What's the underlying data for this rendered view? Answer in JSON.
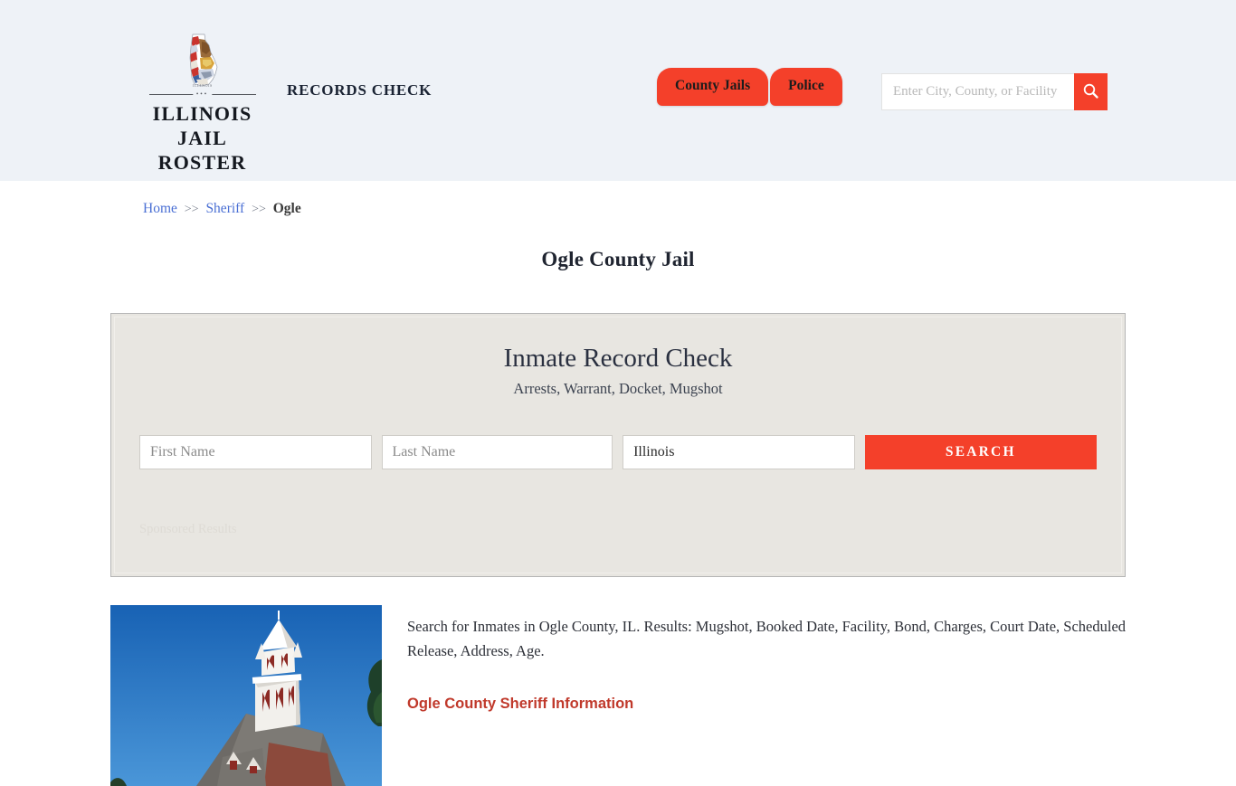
{
  "header": {
    "brand": {
      "line1": "ILLINOIS",
      "line2": "JAIL ROSTER",
      "divider_dots": "•••",
      "state_label": "ILLINOIS",
      "logo_icon": "illinois-state-flag-icon"
    },
    "tagline": "RECORDS CHECK",
    "nav": [
      {
        "label": "County Jails"
      },
      {
        "label": "Police"
      }
    ],
    "search": {
      "placeholder": "Enter City, County, or Facility",
      "value": "",
      "button_icon": "search-icon"
    },
    "background_color": "#eef2f7",
    "accent_color": "#f4402a"
  },
  "breadcrumb": {
    "items": [
      {
        "label": "Home",
        "current": false
      },
      {
        "label": "Sheriff",
        "current": false
      },
      {
        "label": "Ogle",
        "current": true
      }
    ],
    "separator": ">>"
  },
  "page": {
    "title": "Ogle County Jail"
  },
  "search_panel": {
    "title": "Inmate Record Check",
    "subtitle": "Arrests, Warrant, Docket, Mugshot",
    "first_name": {
      "placeholder": "First Name",
      "value": ""
    },
    "last_name": {
      "placeholder": "Last Name",
      "value": ""
    },
    "state": {
      "selected": "Illinois",
      "options": [
        "Illinois"
      ]
    },
    "submit_label": "SEARCH",
    "sponsored_label": "Sponsored Results"
  },
  "content": {
    "photo_alt": "Ogle County Courthouse",
    "paragraph": "Search for Inmates in Ogle County, IL. Results: Mugshot, Booked Date, Facility, Bond, Charges, Court Date, Scheduled Release, Address, Age.",
    "section_heading": "Ogle County Sheriff Information"
  }
}
